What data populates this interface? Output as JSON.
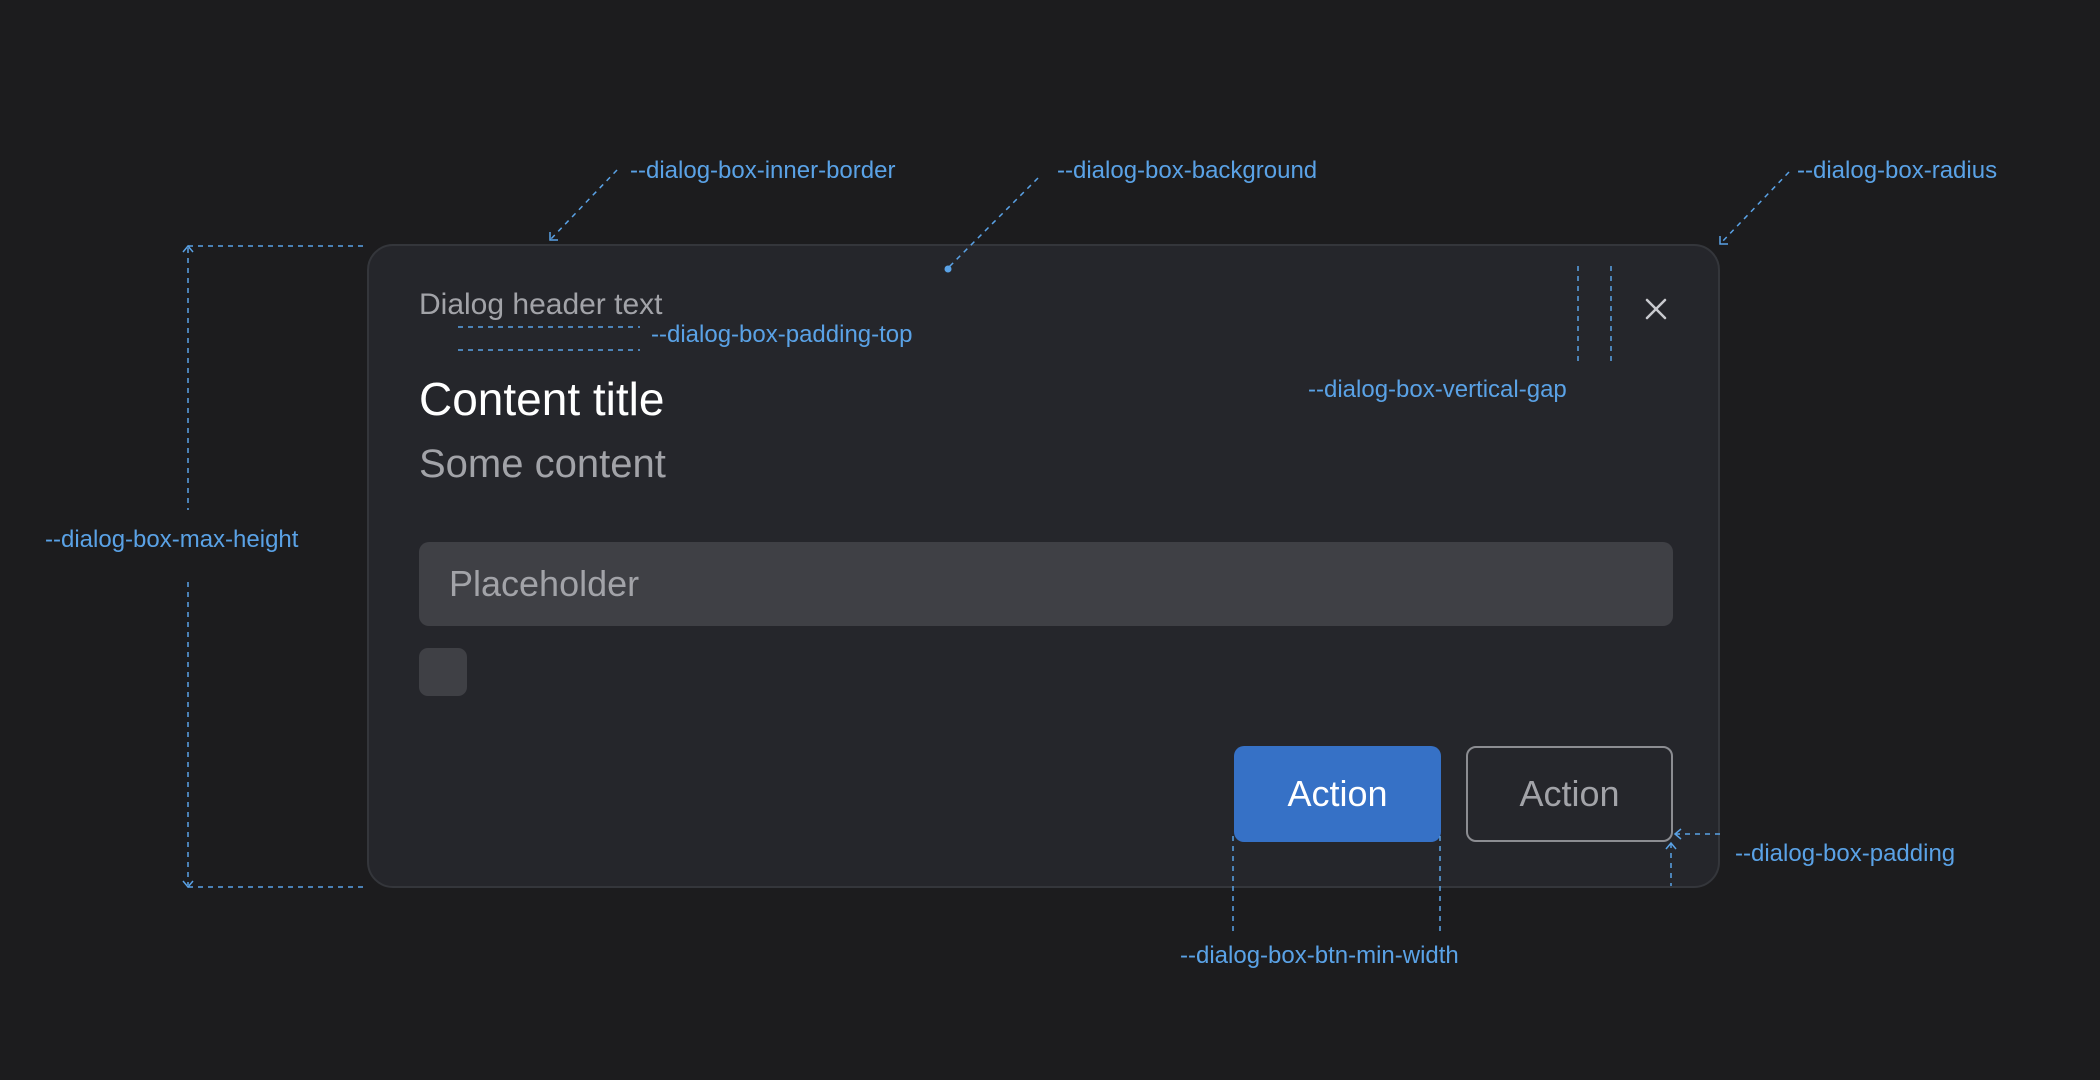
{
  "dialog": {
    "header_text": "Dialog header text",
    "content_title": "Content title",
    "content_body": "Some content",
    "input": {
      "placeholder": "Placeholder",
      "value": ""
    },
    "checkbox_checked": false,
    "primary_action_label": "Action",
    "secondary_action_label": "Action",
    "close_icon": "close-icon"
  },
  "annotations": {
    "inner_border": "--dialog-box-inner-border",
    "background": "--dialog-box-background",
    "radius": "--dialog-box-radius",
    "padding_top": "--dialog-box-padding-top",
    "vertical_gap": "--dialog-box-vertical-gap",
    "max_height": "--dialog-box-max-height",
    "padding": "--dialog-box-padding",
    "btn_min_width": "--dialog-box-btn-min-width"
  },
  "colors": {
    "page_background": "#1c1c1e",
    "dialog_background": "#25262b",
    "dialog_border": "#34363b",
    "primary_button": "#3671c6",
    "input_background": "#3f4045",
    "annotation": "#5aa2e6",
    "muted_text": "#a2a3a8"
  }
}
